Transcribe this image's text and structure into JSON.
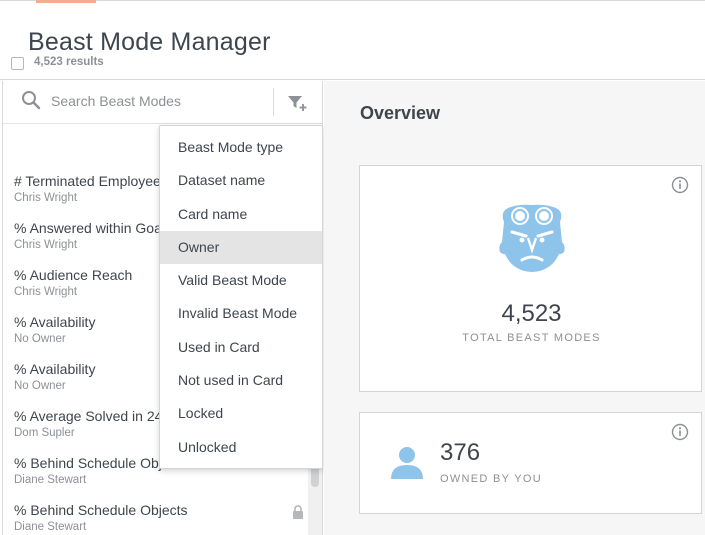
{
  "colors": {
    "accent": "#f4ae8f",
    "icon_blue": "#8ec3ea",
    "text_primary": "#3f454d",
    "text_secondary": "#8d9096",
    "menu_hover": "#e4e4e4"
  },
  "header": {
    "title": "Beast Mode Manager"
  },
  "search": {
    "placeholder": "Search Beast Modes",
    "value": ""
  },
  "results": {
    "count_label": "4,523 results"
  },
  "list": {
    "items": [
      {
        "name": "# Terminated Employees",
        "owner": "Chris Wright",
        "locked": false
      },
      {
        "name": "% Answered within Goal",
        "owner": "Chris Wright",
        "locked": false
      },
      {
        "name": "% Audience Reach",
        "owner": "Chris Wright",
        "locked": false
      },
      {
        "name": "% Availability",
        "owner": "No Owner",
        "locked": false
      },
      {
        "name": "% Availability",
        "owner": "No Owner",
        "locked": false
      },
      {
        "name": "% Average Solved in 24 Hours",
        "owner": "Dom Supler",
        "locked": false
      },
      {
        "name": "% Behind Schedule Objects",
        "owner": "Diane Stewart",
        "locked": false
      },
      {
        "name": "% Behind Schedule Objects",
        "owner": "Diane Stewart",
        "locked": true
      }
    ]
  },
  "filter_menu": {
    "items": [
      {
        "label": "Beast Mode type",
        "active": false
      },
      {
        "label": "Dataset name",
        "active": false
      },
      {
        "label": "Card name",
        "active": false
      },
      {
        "label": "Owner",
        "active": true
      },
      {
        "label": "Valid Beast Mode",
        "active": false
      },
      {
        "label": "Invalid Beast Mode",
        "active": false
      },
      {
        "label": "Used in Card",
        "active": false
      },
      {
        "label": "Not used in Card",
        "active": false
      },
      {
        "label": "Locked",
        "active": false
      },
      {
        "label": "Unlocked",
        "active": false
      }
    ]
  },
  "overview": {
    "title": "Overview",
    "total": {
      "value": "4,523",
      "label": "TOTAL BEAST MODES",
      "icon": "beast-mode-logo-icon"
    },
    "owned": {
      "value": "376",
      "label": "OWNED BY YOU",
      "icon": "user-icon"
    }
  }
}
